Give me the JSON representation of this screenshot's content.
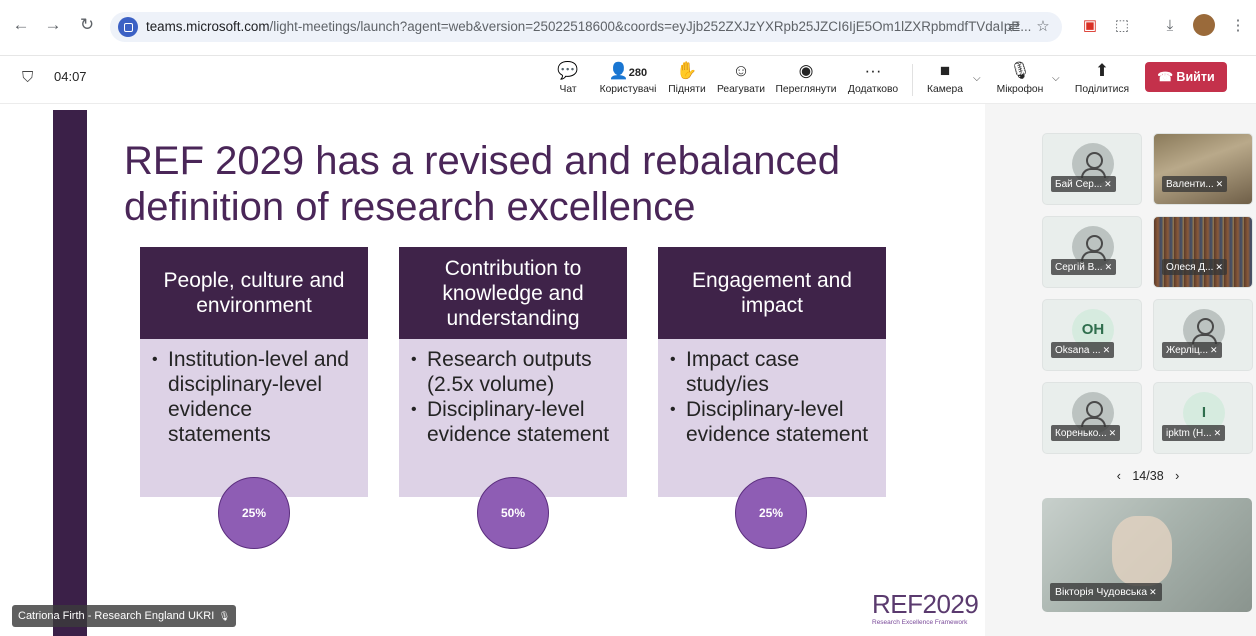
{
  "browser": {
    "url_domain": "teams.microsoft.com",
    "url_path": "/light-meetings/launch?agent=web&version=25022518600&coords=eyJjb252ZXJzYXRpb25JZCI6IjE5Om1lZXRpbmdfTVdaIpE..."
  },
  "toolbar": {
    "timer": "04:07",
    "chat_label": "Чат",
    "participants_count": "280",
    "participants_label": "Користувачі",
    "raise_label": "Підняти",
    "react_label": "Реагувати",
    "view_label": "Переглянути",
    "more_label": "Додатково",
    "camera_label": "Камера",
    "mic_label": "Мікрофон",
    "share_label": "Поділитися",
    "leave_label": "Вийти"
  },
  "slide": {
    "title": "REF 2029 has a revised and rebalanced definition of research excellence",
    "columns": [
      {
        "heading": "People, culture and environment",
        "bullets": [
          "Institution-level and disciplinary-level evidence statements"
        ],
        "weight": "25%"
      },
      {
        "heading": "Contribution to knowledge and understanding",
        "bullets": [
          "Research outputs (2.5x volume)",
          "Disciplinary-level evidence statement"
        ],
        "weight": "50%"
      },
      {
        "heading": "Engagement and impact",
        "bullets": [
          "Impact case study/ies",
          "Disciplinary-level evidence statement"
        ],
        "weight": "25%"
      }
    ],
    "logo_text": "REF2029",
    "logo_sub": "Research Excellence Framework"
  },
  "speaker": {
    "name": "Catriona Firth - Research England UKRI"
  },
  "participants": [
    {
      "name": "Бай Сер..."
    },
    {
      "name": "Валенти..."
    },
    {
      "name": "Сергій В..."
    },
    {
      "name": "Олеся Д..."
    },
    {
      "name": "Oksana ...",
      "initials": "OH"
    },
    {
      "name": "Жерліц..."
    },
    {
      "name": "Коренько..."
    },
    {
      "name": "ipktm (H...",
      "initials": "I"
    }
  ],
  "pager": {
    "current": "14/38"
  },
  "self_view": {
    "name": "Вікторія Чудовська"
  },
  "colors": {
    "leave": "#c4314b",
    "slide_header": "#3f2349",
    "slide_body": "#ddd2e6",
    "circle": "#8e5db4"
  }
}
